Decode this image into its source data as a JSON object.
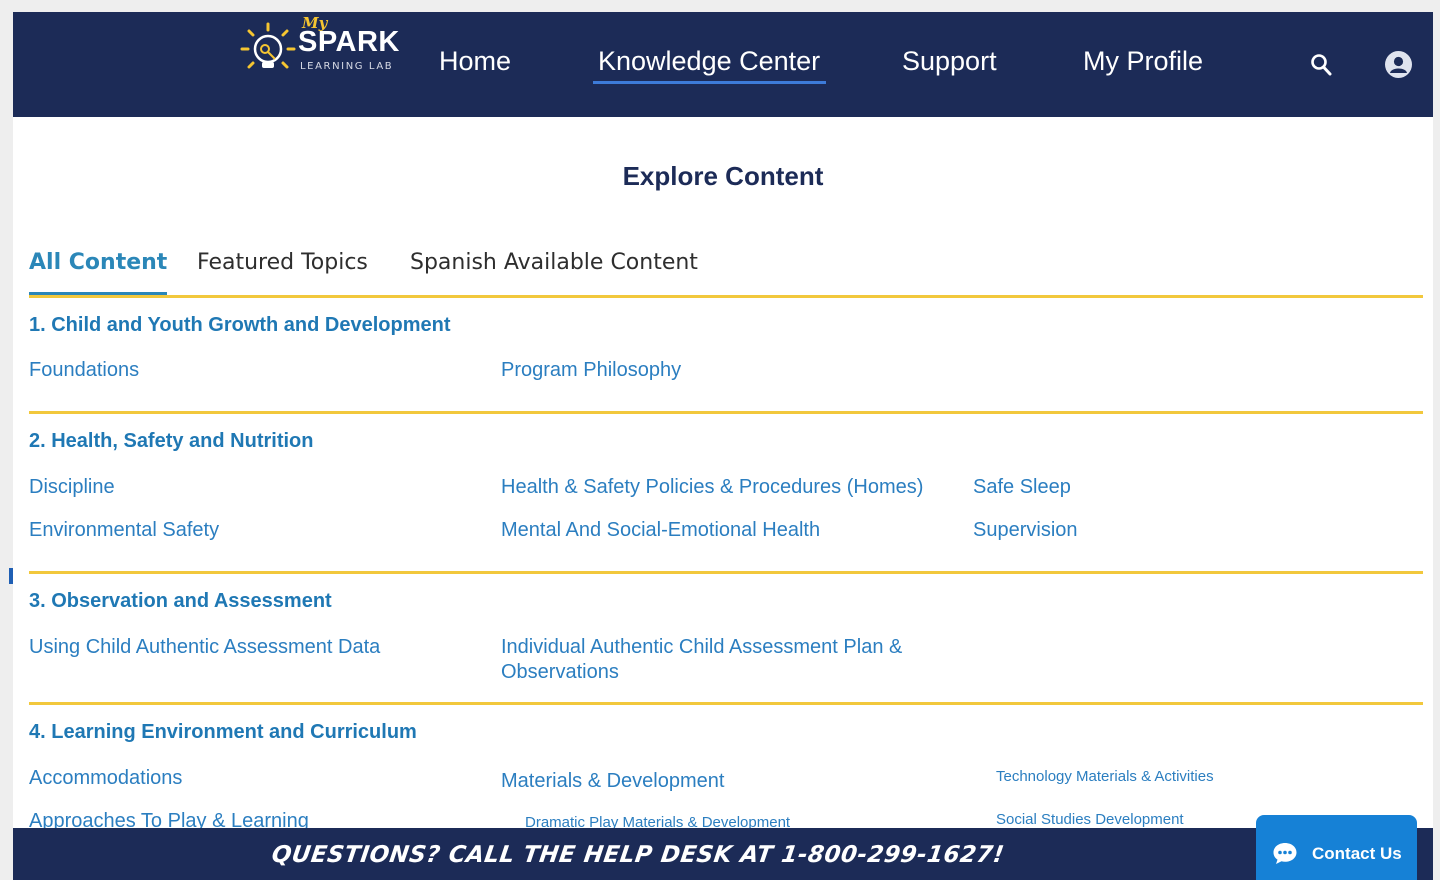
{
  "brand": {
    "logo_my": "My",
    "logo_name": "SPARK",
    "logo_sub": "LEARNING LAB"
  },
  "nav": {
    "items": [
      {
        "label": "Home"
      },
      {
        "label": "Knowledge Center",
        "active": true
      },
      {
        "label": "Support"
      },
      {
        "label": "My Profile"
      }
    ],
    "icons": [
      "search-icon",
      "user-avatar-icon"
    ]
  },
  "page": {
    "title": "Explore Content"
  },
  "tabs": [
    {
      "label": "All Content",
      "active": true
    },
    {
      "label": "Featured Topics"
    },
    {
      "label": "Spanish Available Content"
    }
  ],
  "sections": [
    {
      "title": "1. Child and Youth Growth and Development",
      "links": [
        "Foundations",
        "Program Philosophy"
      ]
    },
    {
      "title": "2. Health, Safety and Nutrition",
      "links": [
        "Discipline",
        "Health & Safety Policies & Procedures (Homes)",
        "Safe Sleep",
        "Environmental Safety",
        "Mental And Social-Emotional Health",
        "Supervision"
      ]
    },
    {
      "title": "3. Observation and Assessment",
      "links": [
        "Using Child Authentic Assessment Data",
        "Individual Authentic Child Assessment Plan & Observations"
      ]
    },
    {
      "title": "4. Learning Environment and Curriculum",
      "links": [
        "Accommodations",
        "Materials & Development",
        "Technology Materials & Activities",
        "Approaches To Play & Learning",
        "Dramatic Play Materials & Development",
        "Social Studies Development"
      ]
    }
  ],
  "banner": {
    "text": "QUESTIONS? CALL THE HELP DESK AT 1-800-299-1627!"
  },
  "contact": {
    "label": "Contact Us"
  },
  "colors": {
    "navy": "#1c2b57",
    "accent_blue": "#2b87b8",
    "link_blue": "#2b7ec0",
    "rule_yellow": "#f2c83c",
    "contact_blue": "#1681d6"
  }
}
